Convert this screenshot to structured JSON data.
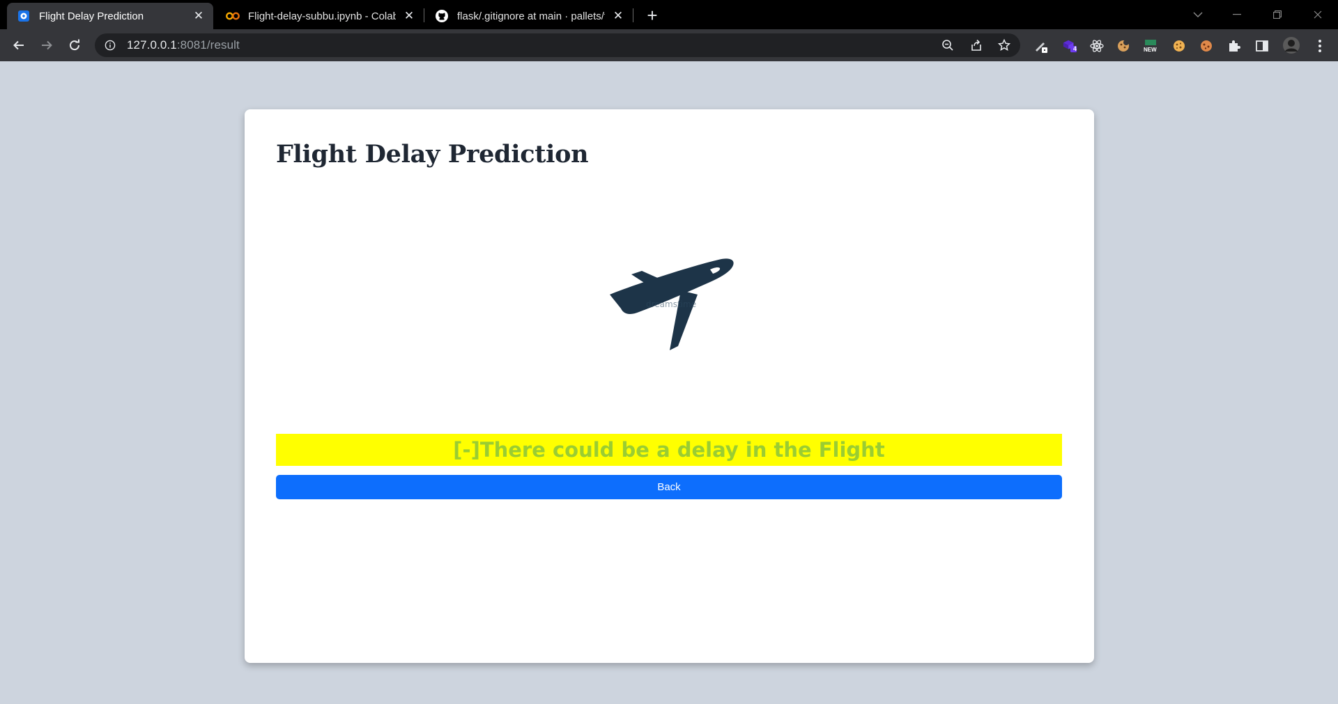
{
  "browser": {
    "tabs": [
      {
        "title": "Flight Delay Prediction",
        "icon": "app-favicon",
        "active": true
      },
      {
        "title": "Flight-delay-subbu.ipynb - Colab",
        "icon": "colab-icon",
        "active": false
      },
      {
        "title": "flask/.gitignore at main · pallets/f",
        "icon": "github-icon",
        "active": false
      }
    ],
    "url_host": "127.0.0.1",
    "url_rest": ":8081/result",
    "extension_badge": "4",
    "extension_new_label": "NEW"
  },
  "page": {
    "heading": "Flight Delay Prediction",
    "illustration": "airplane-icon",
    "illustration_watermark": "dreamstime",
    "result_text": "[-]There could be a delay in the Flight",
    "back_label": "Back"
  },
  "colors": {
    "background": "#cdd4de",
    "card": "#ffffff",
    "heading": "#1f2733",
    "plane": "#1d3448",
    "result_bg": "#ffff00",
    "result_text": "#9acd32",
    "button": "#0d6efd"
  }
}
